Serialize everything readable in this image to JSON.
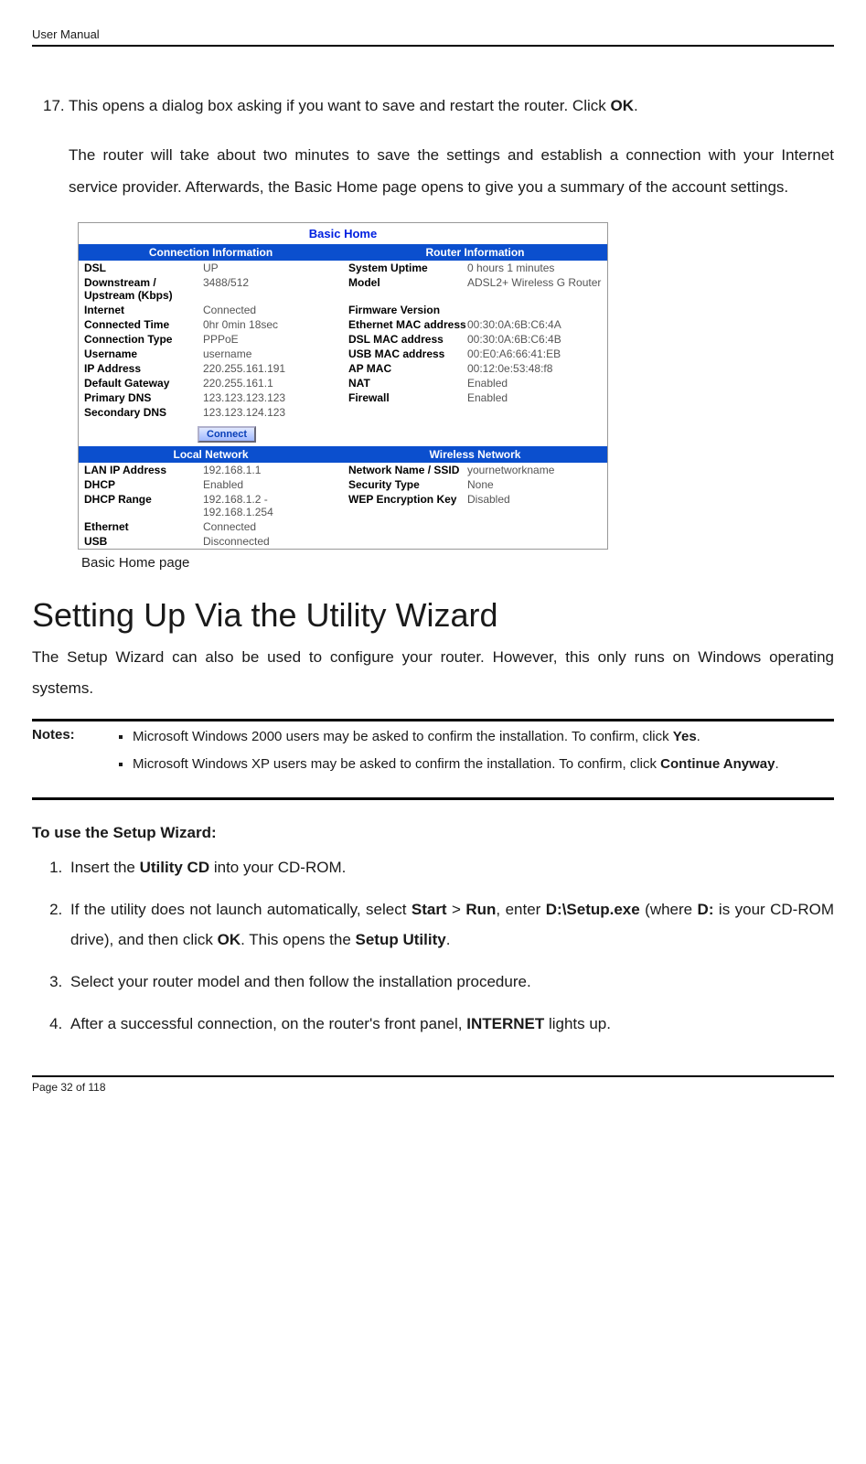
{
  "header": {
    "label": "User Manual"
  },
  "step17": {
    "num": "17.",
    "line1a": "This opens a dialog box asking if you want to save and restart the router. Click ",
    "ok": "OK",
    "line1b": ".",
    "para": "The router will take about two minutes to save the settings and establish a connection with your Internet service provider. Afterwards, the Basic Home page opens to give you a summary of the account settings."
  },
  "fig": {
    "title": "Basic Home",
    "bar1_left": "Connection Information",
    "bar1_right": "Router Information",
    "ci_rows": [
      {
        "l": "DSL",
        "v": "UP"
      },
      {
        "l": "Downstream / Upstream (Kbps)",
        "v": "3488/512"
      },
      {
        "l": "Internet",
        "v": "Connected"
      },
      {
        "l": "Connected Time",
        "v": "0hr 0min 18sec"
      },
      {
        "l": "Connection Type",
        "v": "PPPoE"
      },
      {
        "l": "Username",
        "v": "username"
      },
      {
        "l": "IP Address",
        "v": "220.255.161.191"
      },
      {
        "l": "Default Gateway",
        "v": "220.255.161.1"
      },
      {
        "l": "Primary DNS",
        "v": "123.123.123.123"
      },
      {
        "l": "Secondary DNS",
        "v": "123.123.124.123"
      }
    ],
    "ri_rows": [
      {
        "l": "System Uptime",
        "v": "0 hours 1 minutes"
      },
      {
        "l": "Model",
        "v": "ADSL2+ Wireless G Router"
      },
      {
        "l": "Firmware Version",
        "v": ""
      },
      {
        "l": "Ethernet MAC address",
        "v": "00:30:0A:6B:C6:4A"
      },
      {
        "l": "DSL MAC address",
        "v": "00:30:0A:6B:C6:4B"
      },
      {
        "l": "USB MAC address",
        "v": "00:E0:A6:66:41:EB"
      },
      {
        "l": "AP MAC",
        "v": "00:12:0e:53:48:f8"
      },
      {
        "l": "NAT",
        "v": "Enabled"
      },
      {
        "l": "Firewall",
        "v": "Enabled"
      }
    ],
    "connect_btn": "Connect",
    "bar2_left": "Local Network",
    "bar2_right": "Wireless Network",
    "ln_rows": [
      {
        "l": "LAN IP Address",
        "v": "192.168.1.1"
      },
      {
        "l": "DHCP",
        "v": "Enabled"
      },
      {
        "l": "DHCP Range",
        "v": "192.168.1.2 - 192.168.1.254"
      },
      {
        "l": "Ethernet",
        "v": "Connected"
      },
      {
        "l": "USB",
        "v": "Disconnected"
      }
    ],
    "wn_rows": [
      {
        "l": "Network Name / SSID",
        "v": "yournetworkname"
      },
      {
        "l": "Security Type",
        "v": "None"
      },
      {
        "l": "WEP Encryption Key",
        "v": "Disabled"
      }
    ],
    "caption": "Basic Home page"
  },
  "section": {
    "title": "Setting Up Via the Utility Wizard",
    "desc": "The Setup Wizard can also be used to configure your router. However, this only runs on Windows operating systems."
  },
  "notes": {
    "label": "Notes:",
    "item1a": "Microsoft Windows 2000 users may be asked to confirm the installation. To confirm, click ",
    "item1b": "Yes",
    "item1c": ".",
    "item2a": "Microsoft Windows XP users may be asked to confirm the installation. To confirm, click ",
    "item2b": "Continue Anyway",
    "item2c": "."
  },
  "wizard": {
    "heading": "To use the Setup Wizard:",
    "step1a": "Insert the ",
    "step1b": "Utility CD",
    "step1c": " into your CD-ROM.",
    "step2a": "If the utility does not launch automatically, select ",
    "step2b": "Start",
    "step2c": " > ",
    "step2d": "Run",
    "step2e": ", enter ",
    "step2f": "D:\\Setup.exe",
    "step2g": " (where ",
    "step2h": "D:",
    "step2i": " is your CD-ROM drive), and then click ",
    "step2j": "OK",
    "step2k": ". This opens the ",
    "step2l": "Setup Utility",
    "step2m": ".",
    "step3": "Select your router model and then follow the installation procedure.",
    "step4a": "After a successful connection, on the router's front panel, ",
    "step4b": "INTERNET",
    "step4c": " lights up."
  },
  "footer": {
    "page": "Page 32 of 118"
  }
}
